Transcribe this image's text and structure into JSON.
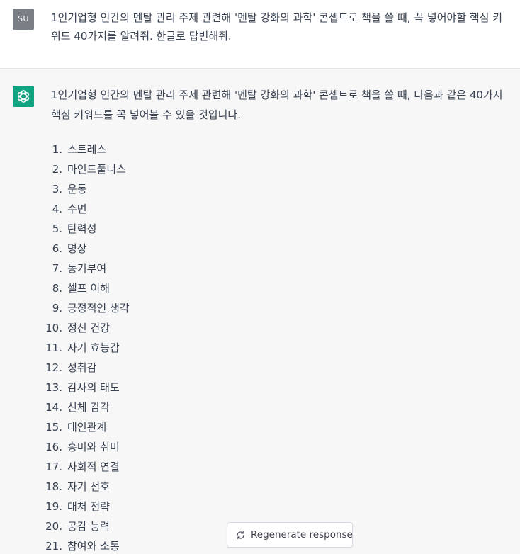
{
  "user_message": {
    "avatar_label": "SU",
    "text": "1인기업형 인간의 멘탈 관리 주제 관련해 '멘탈 강화의 과학' 콘셉트로 책을 쓸 때, 꼭 넣어야할 핵심 키워드 40가지를 알려줘. 한글로 답변해줘."
  },
  "assistant_message": {
    "intro": "1인기업형 인간의 멘탈 관리 주제 관련해 '멘탈 강화의 과학' 콘셉트로 책을 쓸 때, 다음과 같은 40가지 핵심 키워드를 꼭 넣어볼 수 있을 것입니다.",
    "keywords": [
      {
        "num": "1.",
        "text": "스트레스"
      },
      {
        "num": "2.",
        "text": "마인드풀니스"
      },
      {
        "num": "3.",
        "text": "운동"
      },
      {
        "num": "4.",
        "text": "수면"
      },
      {
        "num": "5.",
        "text": "탄력성"
      },
      {
        "num": "6.",
        "text": "명상"
      },
      {
        "num": "7.",
        "text": "동기부여"
      },
      {
        "num": "8.",
        "text": "셀프 이해"
      },
      {
        "num": "9.",
        "text": "긍정적인 생각"
      },
      {
        "num": "10.",
        "text": "정신 건강"
      },
      {
        "num": "11.",
        "text": "자기 효능감"
      },
      {
        "num": "12.",
        "text": "성취감"
      },
      {
        "num": "13.",
        "text": "감사의 태도"
      },
      {
        "num": "14.",
        "text": "신체 감각"
      },
      {
        "num": "15.",
        "text": "대인관계"
      },
      {
        "num": "16.",
        "text": "흥미와 취미"
      },
      {
        "num": "17.",
        "text": "사회적 연결"
      },
      {
        "num": "18.",
        "text": "자기 선호"
      },
      {
        "num": "19.",
        "text": "대처 전략"
      },
      {
        "num": "20.",
        "text": "공감 능력"
      },
      {
        "num": "21.",
        "text": "참여와 소통"
      }
    ]
  },
  "regenerate_button": {
    "label": "Regenerate response",
    "icon": "refresh-icon"
  },
  "colors": {
    "assistant_bg": "#f7f7f8",
    "assistant_avatar": "#10a37f",
    "user_avatar": "#7a7f86",
    "text": "#374151"
  }
}
